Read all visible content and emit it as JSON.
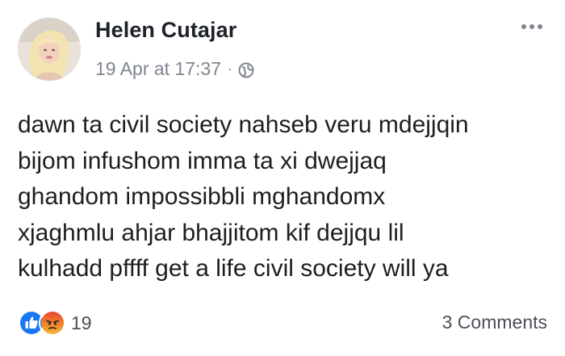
{
  "post": {
    "author": "Helen Cutajar",
    "timestamp": "19 Apr at 17:37",
    "separator": "·",
    "privacy_icon": "globe-icon",
    "text": "dawn ta civil society nahseb veru mdejjqin\nbijom infushom imma ta xi dwejjaq\nghandom impossibbli mghandomx\nxjaghmlu ahjar bhajjitom kif dejjqu lil\nkulhadd pffff get a life civil society will ya"
  },
  "reactions": {
    "icons": [
      "like-icon",
      "angry-icon"
    ],
    "count": "19"
  },
  "comments": {
    "label": "3 Comments"
  },
  "colors": {
    "name": "#1d2129",
    "meta": "#7f8590",
    "like_blue": "#1877f2",
    "angry_orange": "#f0603a"
  }
}
